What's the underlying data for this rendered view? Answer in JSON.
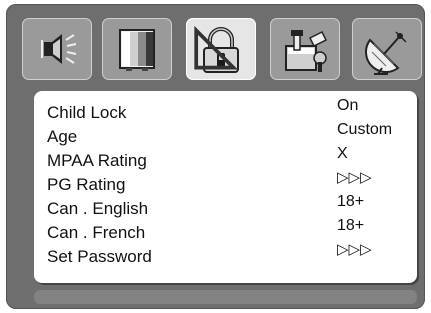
{
  "menu": {
    "tabs": [
      {
        "icon": "speaker-icon",
        "active": false
      },
      {
        "icon": "tv-screen-icon",
        "active": false
      },
      {
        "icon": "padlock-icon",
        "active": true
      },
      {
        "icon": "tools-setup-icon",
        "active": false
      },
      {
        "icon": "satellite-dish-icon",
        "active": false
      }
    ]
  },
  "settings": {
    "rows": [
      {
        "label": "Child Lock",
        "value": "On"
      },
      {
        "label": "Age",
        "value": "Custom"
      },
      {
        "label": "MPAA Rating",
        "value": "X"
      },
      {
        "label": "PG Rating",
        "value": "▷▷▷"
      },
      {
        "label": "Can . English",
        "value": "18+"
      },
      {
        "label": "Can . French",
        "value": "18+"
      },
      {
        "label": "Set Password",
        "value": "▷▷▷"
      }
    ]
  },
  "colors": {
    "frame": "#6e6e6e",
    "tab_inactive": "#9a9a9a",
    "tab_active": "#e6e6e6",
    "panel": "#ffffff",
    "text": "#111111"
  }
}
